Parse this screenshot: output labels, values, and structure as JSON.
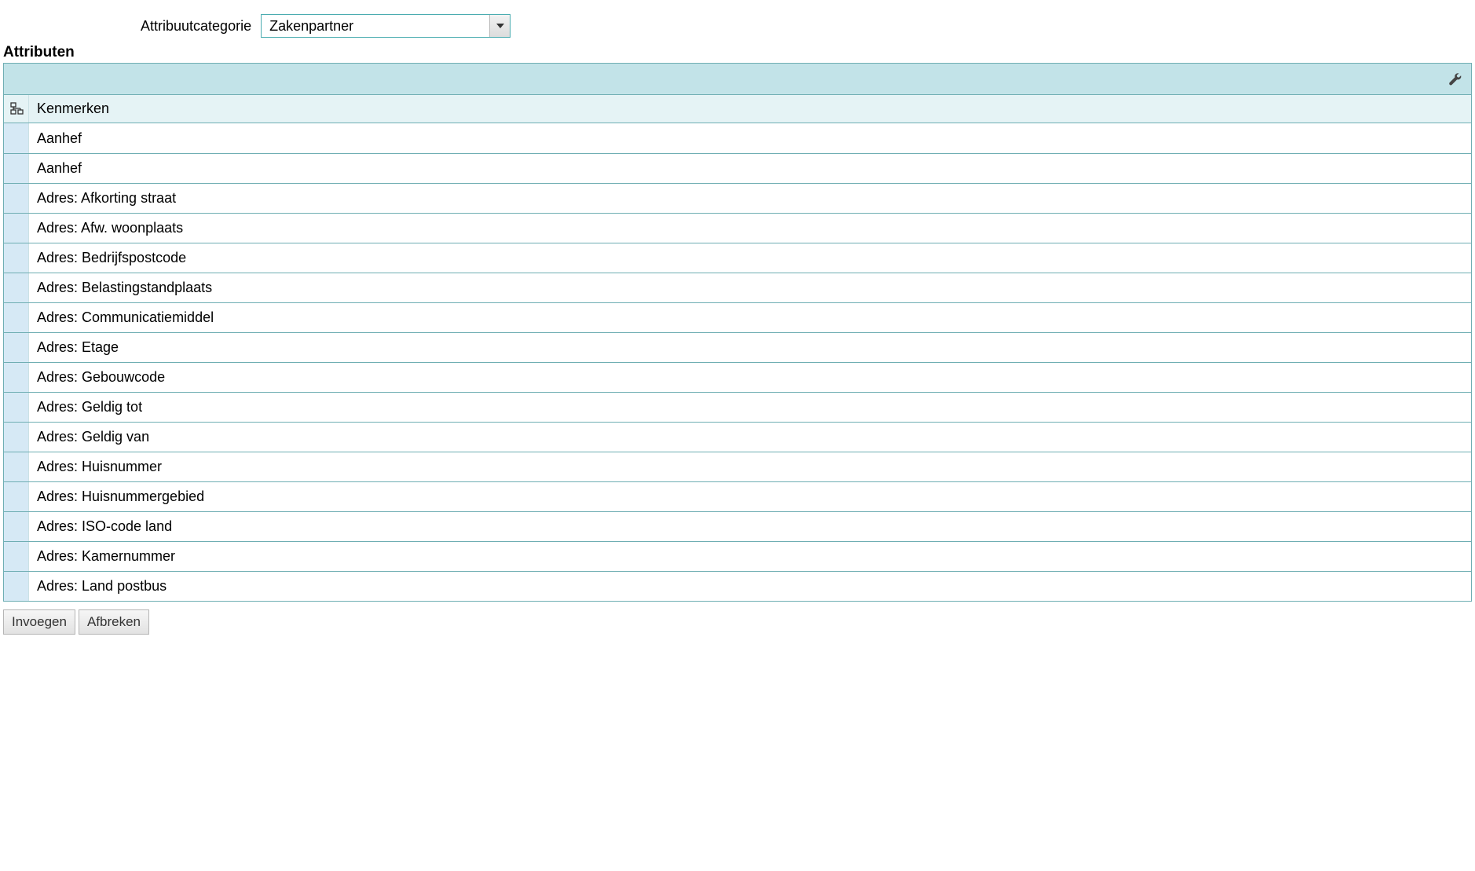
{
  "top": {
    "label": "Attribuutcategorie",
    "value": "Zakenpartner"
  },
  "section_title": "Attributen",
  "grid": {
    "column_header": "Kenmerken",
    "items": [
      {
        "label": "Aanhef"
      },
      {
        "label": "Aanhef"
      },
      {
        "label": "Adres: Afkorting straat"
      },
      {
        "label": "Adres: Afw. woonplaats"
      },
      {
        "label": "Adres: Bedrijfspostcode"
      },
      {
        "label": "Adres: Belastingstandplaats"
      },
      {
        "label": "Adres: Communicatiemiddel"
      },
      {
        "label": "Adres: Etage"
      },
      {
        "label": "Adres: Gebouwcode"
      },
      {
        "label": "Adres: Geldig tot"
      },
      {
        "label": "Adres: Geldig van"
      },
      {
        "label": "Adres: Huisnummer"
      },
      {
        "label": "Adres: Huisnummergebied"
      },
      {
        "label": "Adres: ISO-code land"
      },
      {
        "label": "Adres: Kamernummer"
      },
      {
        "label": "Adres: Land postbus"
      }
    ]
  },
  "buttons": {
    "insert": "Invoegen",
    "cancel": "Afbreken"
  }
}
